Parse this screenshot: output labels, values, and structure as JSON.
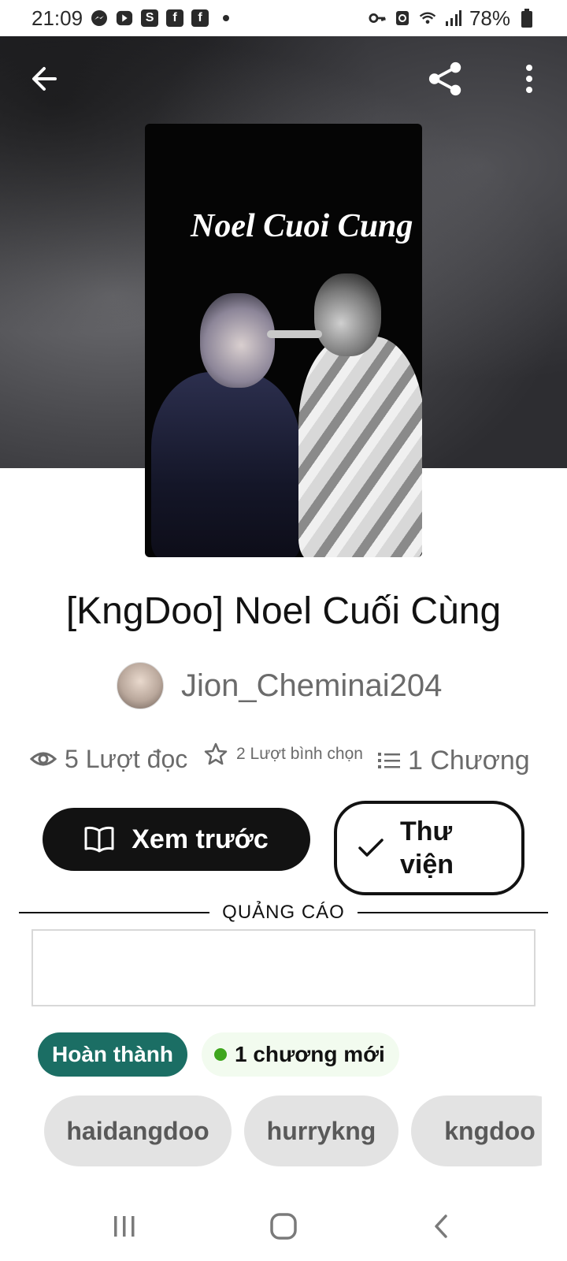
{
  "status_bar": {
    "time": "21:09",
    "battery": "78%",
    "left_icons": [
      "messenger-icon",
      "youtube-icon",
      "shopee-icon",
      "facebook-icon",
      "facebook-icon",
      "dot-icon"
    ],
    "right_icons": [
      "key-icon",
      "recycle-icon",
      "wifi-icon",
      "signal-icon",
      "battery-icon"
    ]
  },
  "header": {
    "back_icon": "arrow-left-icon",
    "share_icon": "share-icon",
    "more_icon": "more-vertical-icon"
  },
  "cover": {
    "title_text": "Noel Cuoi Cung"
  },
  "story": {
    "title": "[KngDoo] Noel Cuối Cùng",
    "author": "Jion_Cheminai204"
  },
  "stats": {
    "reads": "5 Lượt đọc",
    "votes": "2 Lượt bình chọn",
    "chapters": "1 Chương"
  },
  "actions": {
    "preview_label": "Xem trước",
    "library_label": "Thư viện"
  },
  "ad": {
    "label": "QUẢNG CÁO"
  },
  "badges": {
    "status": "Hoàn thành",
    "new_chapters": "1 chương mới"
  },
  "tags": [
    "haidangdoo",
    "hurrykng",
    "kngdoo"
  ],
  "colors": {
    "dark": "#121212",
    "complete_badge": "#1b6e64",
    "new_dot": "#3ea61d",
    "tag_bg": "#e3e3e3",
    "muted_text": "#6b6b6b"
  },
  "nav_bar": {
    "recents_icon": "recent-apps-icon",
    "home_icon": "home-icon",
    "back_icon": "nav-back-icon"
  }
}
